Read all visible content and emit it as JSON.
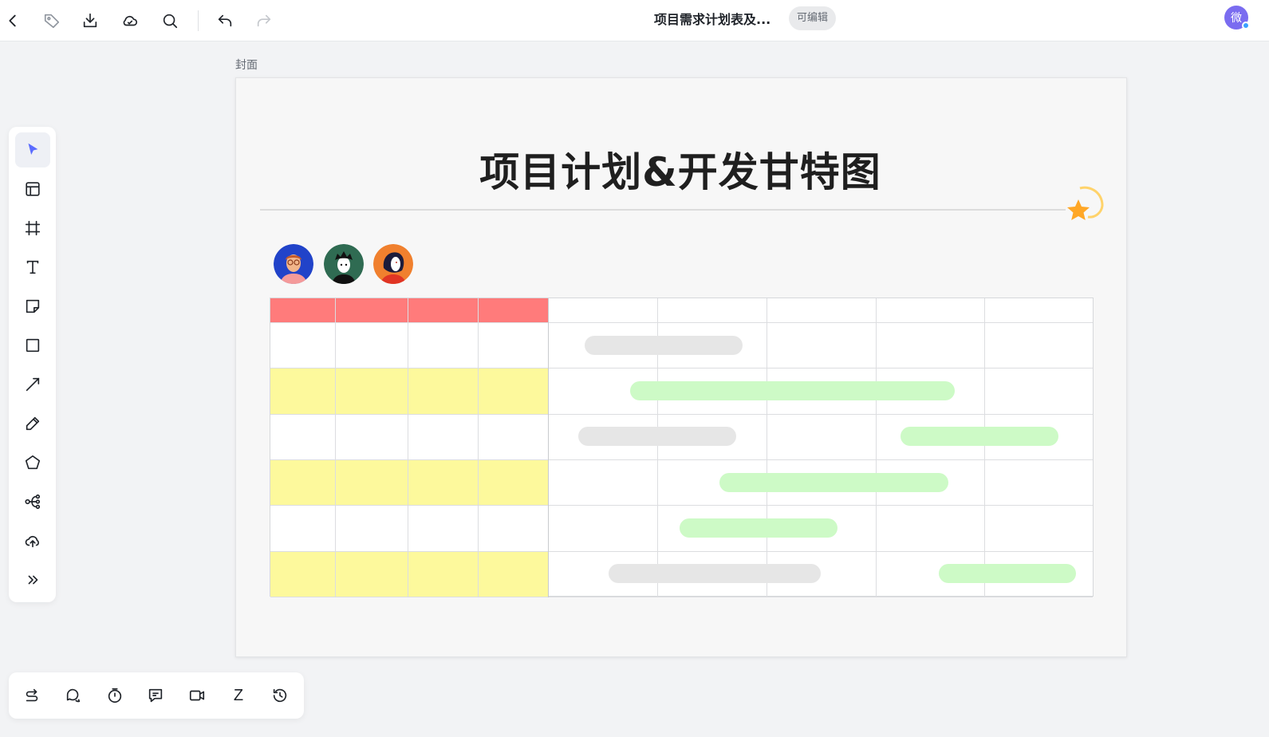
{
  "app": {
    "doc_title": "项目需求计划表及...",
    "edit_badge": "可编辑",
    "user_avatar_char": "微"
  },
  "topbar": {
    "icons": [
      "back-icon",
      "tag-icon",
      "download-icon",
      "cloud-icon",
      "search-icon",
      "undo-icon",
      "redo-icon"
    ]
  },
  "left_toolbar": {
    "tools": [
      "select-tool",
      "template-tool",
      "frame-tool",
      "text-tool",
      "sticky-note-tool",
      "shape-tool",
      "line-tool",
      "pen-tool",
      "polygon-tool",
      "mindmap-tool",
      "upload-tool",
      "more-tools"
    ],
    "active": "select-tool"
  },
  "bottom_toolbar": {
    "tools": [
      "switch-icon",
      "chat-icon",
      "timer-icon",
      "comment-icon",
      "video-icon",
      "sleep-icon",
      "history-icon"
    ],
    "sleep_glyph": "Z"
  },
  "frame": {
    "label": "封面",
    "title": "项目计划&开发甘特图",
    "avatars": [
      "avatar-glasses-man",
      "avatar-spiky-hair",
      "avatar-woman-red"
    ]
  },
  "gantt": {
    "left_columns": 4,
    "right_columns": 5,
    "rows": 6,
    "header_color": "#ff7b7b",
    "row_colors": [
      "#ffffff",
      "#fdf99c",
      "#ffffff",
      "#fdf99c",
      "#ffffff",
      "#fdf99c"
    ],
    "bar_colors": {
      "gray": "#e6e6e6",
      "green": "#cdfac6"
    }
  }
}
